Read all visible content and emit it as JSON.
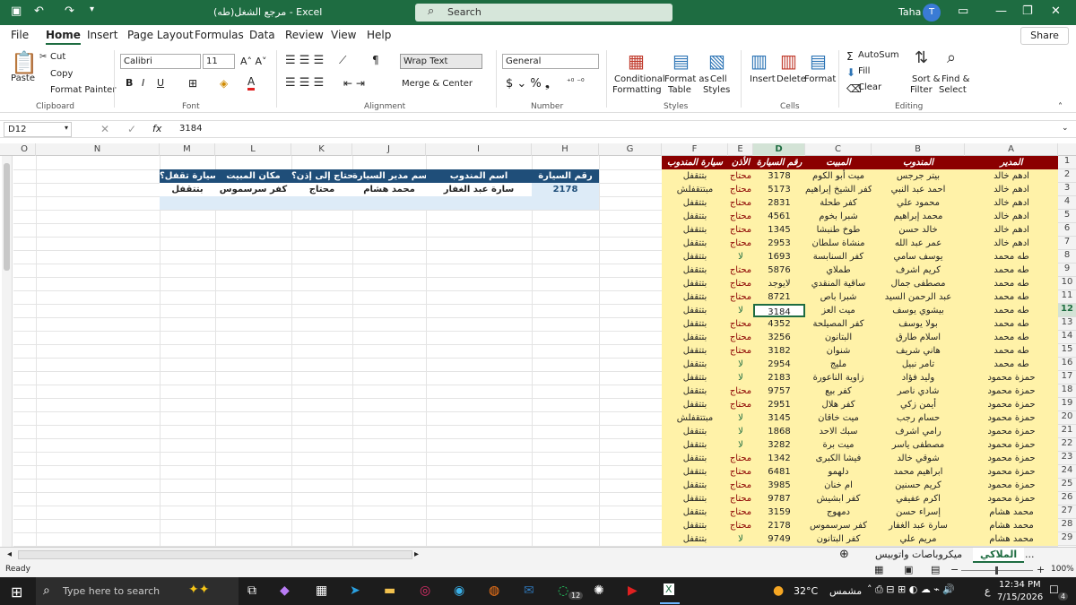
{
  "titlebar": {
    "doc_title": "مرجع الشغل(طه) - Excel",
    "search_placeholder": "Search",
    "user": "Taha",
    "avatar": "T"
  },
  "menu": [
    "File",
    "Home",
    "Insert",
    "Page Layout",
    "Formulas",
    "Data",
    "Review",
    "View",
    "Help"
  ],
  "share": "Share",
  "ribbon": {
    "paste": "Paste",
    "cut": "Cut",
    "copy": "Copy",
    "format_painter": "Format Painter",
    "clipboard": "Clipboard",
    "font_name": "Calibri",
    "font_size": "11",
    "font_group": "Font",
    "wrap_text": "Wrap Text",
    "merge_center": "Merge & Center",
    "alignment": "Alignment",
    "number_format": "General",
    "number": "Number",
    "conditional": "Conditional",
    "formatting": "Formatting",
    "format_as": "Format as",
    "table": "Table",
    "cell": "Cell",
    "styles_btn": "Styles",
    "styles": "Styles",
    "insert": "Insert",
    "delete": "Delete",
    "format": "Format",
    "cells": "Cells",
    "autosum": "AutoSum",
    "fill": "Fill",
    "clear": "Clear",
    "sort": "Sort &",
    "filter": "Filter",
    "find": "Find &",
    "select": "Select",
    "editing": "Editing"
  },
  "formula": {
    "namebox": "D12",
    "value": "3184"
  },
  "columns": [
    "O",
    "N",
    "M",
    "L",
    "K",
    "J",
    "I",
    "H",
    "G",
    "F",
    "E",
    "D",
    "C",
    "B",
    "A"
  ],
  "left_table": {
    "headers": [
      "السيارة تقفل؟",
      "مكان المبيت",
      "يحتاج إلى إذن؟",
      "اسم مدير السيارة",
      "اسم المندوب",
      "رقم السيارة"
    ],
    "row": [
      "بتتقفل",
      "كفر سرسموس",
      "محتاج",
      "محمد هشام",
      "سارة عبد الغفار",
      "2178"
    ]
  },
  "main_headers": [
    "سيارة المندوب",
    "الأذن",
    "رقم السيارة",
    "المبيت",
    "المندوب",
    "المدير"
  ],
  "rows": [
    [
      "بتتقفل",
      "محتاج",
      "3178",
      "ميت أبو الكوم",
      "بيتر جرجس",
      "ادهم خالد"
    ],
    [
      "مبتتقفلش",
      "محتاج",
      "5173",
      "كفر الشيخ إبراهيم",
      "احمد عبد النبي",
      "ادهم خالد"
    ],
    [
      "بتتقفل",
      "محتاج",
      "2831",
      "كفر طحلة",
      "محمود علي",
      "ادهم خالد"
    ],
    [
      "بتتقفل",
      "محتاج",
      "4561",
      "شبرا بخوم",
      "محمد إبراهيم",
      "ادهم خالد"
    ],
    [
      "بتتقفل",
      "محتاج",
      "1345",
      "طوخ طنبشا",
      "خالد حسن",
      "ادهم خالد"
    ],
    [
      "بتتقفل",
      "محتاج",
      "2953",
      "منشاة سلطان",
      "عمر عبد الله",
      "ادهم خالد"
    ],
    [
      "بتتقفل",
      "لا",
      "1693",
      "كفر السنابسة",
      "يوسف سامي",
      "طه محمد"
    ],
    [
      "بتتقفل",
      "محتاج",
      "5876",
      "طملاي",
      "كريم اشرف",
      "طه محمد"
    ],
    [
      "بتتقفل",
      "محتاج",
      "لايوجد",
      "ساقية المنقدي",
      "مصطفى جمال",
      "طه محمد"
    ],
    [
      "بتتقفل",
      "محتاج",
      "8721",
      "شبرا باص",
      "عبد الرحمن السيد",
      "طه محمد"
    ],
    [
      "بتتقفل",
      "لا",
      "3184",
      "ميت العز",
      "بيشوي يوسف",
      "طه محمد"
    ],
    [
      "بتتقفل",
      "محتاج",
      "4352",
      "كفر المصيلحة",
      "بولا يوسف",
      "طه محمد"
    ],
    [
      "بتتقفل",
      "محتاج",
      "3256",
      "البتانون",
      "اسلام طارق",
      "طه محمد"
    ],
    [
      "بتتقفل",
      "محتاج",
      "3182",
      "شنوان",
      "هاني شريف",
      "طه محمد"
    ],
    [
      "بتتقفل",
      "لا",
      "2954",
      "مليج",
      "تامر نبيل",
      "طه محمد"
    ],
    [
      "بتتقفل",
      "لا",
      "2183",
      "زاوية الناعورة",
      "وليد فؤاد",
      "حمزة محمود"
    ],
    [
      "بتتقفل",
      "محتاج",
      "9757",
      "كفر بيع",
      "شادي ناصر",
      "حمزة محمود"
    ],
    [
      "بتتقفل",
      "محتاج",
      "2951",
      "كفر هلال",
      "أيمن زكي",
      "حمزة محمود"
    ],
    [
      "مبتتقفلش",
      "لا",
      "3145",
      "ميت خاقان",
      "حسام رجب",
      "حمزة محمود"
    ],
    [
      "بتتقفل",
      "لا",
      "1868",
      "سبك الاحد",
      "رامي اشرف",
      "حمزة محمود"
    ],
    [
      "بتتقفل",
      "لا",
      "3282",
      "ميت برة",
      "مصطفى ياسر",
      "حمزة محمود"
    ],
    [
      "بتتقفل",
      "محتاج",
      "1342",
      "فيشا الكبرى",
      "شوقي خالد",
      "حمزة محمود"
    ],
    [
      "بتتقفل",
      "محتاج",
      "6481",
      "دلهمو",
      "ابراهيم محمد",
      "حمزة محمود"
    ],
    [
      "بتتقفل",
      "محتاج",
      "3985",
      "ام خنان",
      "كريم حسنين",
      "حمزة محمود"
    ],
    [
      "بتتقفل",
      "محتاج",
      "9787",
      "كفر ابشيش",
      "اكرم عفيفي",
      "حمزة محمود"
    ],
    [
      "بتتقفل",
      "محتاج",
      "3159",
      "دمهوج",
      "إسراء حسن",
      "محمد هشام"
    ],
    [
      "بتتقفل",
      "محتاج",
      "2178",
      "كفر سرسموس",
      "سارة عبد الغفار",
      "محمد هشام"
    ],
    [
      "بتتقفل",
      "لا",
      "9749",
      "كفر البتانون",
      "مريم علي",
      "محمد هشام"
    ]
  ],
  "sheets": [
    "...",
    "الملاكي",
    "ميكروباصات واتوبيس"
  ],
  "status": {
    "ready": "Ready",
    "zoom": "100%"
  },
  "taskbar": {
    "search": "Type here to search",
    "weather": "32°C",
    "weather_label": "مشمس",
    "time": "12:34 PM",
    "date": "7/15/2026",
    "lang": "ع",
    "badge12": "12",
    "badge4": "4"
  }
}
